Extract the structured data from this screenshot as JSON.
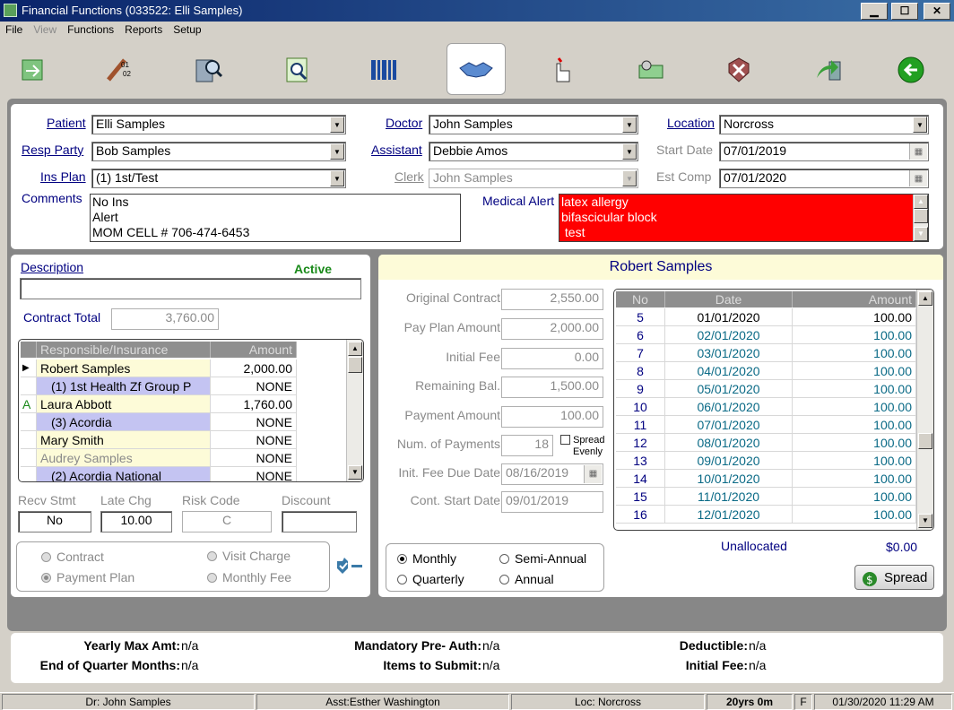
{
  "window": {
    "title": "Financial Functions (033522: Elli Samples)",
    "min": "▁",
    "max": "☐",
    "close": "✕"
  },
  "menu": {
    "file": "File",
    "view": "View",
    "functions": "Functions",
    "reports": "Reports",
    "setup": "Setup"
  },
  "toolbar": {
    "icons": [
      "transfer-icon",
      "calendar-dates-icon",
      "calculator-search-icon",
      "document-search-icon",
      "barcode-icon",
      "handshake-icon",
      "hand-pointer-icon",
      "money-gear-icon",
      "cancel-shield-icon",
      "arrow-forward-icon",
      "back-arrow-icon"
    ],
    "active_index": 5
  },
  "header": {
    "patient_label": "Patient",
    "patient": "Elli Samples",
    "resp_label": "Resp Party",
    "resp": "Bob Samples",
    "ins_label": "Ins Plan",
    "ins": "(1) 1st/Test",
    "comments_label": "Comments",
    "comments": [
      "No Ins",
      "Alert",
      "MOM CELL # 706-474-6453"
    ],
    "doctor_label": "Doctor",
    "doctor": "John Samples",
    "assistant_label": "Assistant",
    "assistant": "Debbie Amos",
    "clerk_label": "Clerk",
    "clerk": "John Samples",
    "location_label": "Location",
    "location": "Norcross",
    "start_label": "Start Date",
    "start": "07/01/2019",
    "estcomp_label": "Est Comp",
    "estcomp": "07/01/2020",
    "medalert_label": "Medical Alert",
    "medalert": [
      "latex allergy",
      "bifascicular block",
      " test"
    ]
  },
  "left": {
    "description_label": "Description",
    "status": "Active",
    "description": "",
    "contract_total_label": "Contract Total",
    "contract_total": "3,760.00",
    "grid_headers": [
      "Responsible/Insurance",
      "Amount"
    ],
    "rows": [
      {
        "marker": "▶",
        "name": "Robert Samples",
        "amount": "2,000.00",
        "style": "yellow"
      },
      {
        "marker": "",
        "name": "(1) 1st Health Zf Group P",
        "amount": "NONE",
        "style": "lav"
      },
      {
        "marker": "A",
        "name": "Laura Abbott",
        "amount": "1,760.00",
        "style": "yellow"
      },
      {
        "marker": "",
        "name": "(3) Acordia",
        "amount": "NONE",
        "style": "lav"
      },
      {
        "marker": "",
        "name": "Mary Smith",
        "amount": "NONE",
        "style": "yellow"
      },
      {
        "marker": "",
        "name": "Audrey Samples",
        "amount": "NONE",
        "style": "yellowgray"
      },
      {
        "marker": "",
        "name": "(2) Acordia National",
        "amount": "NONE",
        "style": "lav"
      }
    ],
    "recv_label": "Recv Stmt",
    "recv": "No",
    "late_label": "Late Chg",
    "late": "10.00",
    "risk_label": "Risk Code",
    "risk": "C",
    "discount_label": "Discount",
    "discount": "",
    "radio_contract": "Contract",
    "radio_payplan": "Payment Plan",
    "radio_visit": "Visit Charge",
    "radio_monthly_fee": "Monthly Fee"
  },
  "right": {
    "name": "Robert Samples",
    "orig_label": "Original Contract",
    "orig": "2,550.00",
    "payplan_label": "Pay Plan Amount",
    "payplan": "2,000.00",
    "initfee_label": "Initial Fee",
    "initfee": "0.00",
    "remain_label": "Remaining Bal.",
    "remain": "1,500.00",
    "payamt_label": "Payment Amount",
    "payamt": "100.00",
    "numpay_label": "Num. of Payments",
    "numpay": "18",
    "spread_evenly_1": "Spread",
    "spread_evenly_2": "Evenly",
    "initdue_label": "Init. Fee Due Date",
    "initdue": "08/16/2019",
    "contstart_label": "Cont. Start Date",
    "contstart": "09/01/2019",
    "freq": {
      "monthly": "Monthly",
      "semi": "Semi-Annual",
      "quarterly": "Quarterly",
      "annual": "Annual"
    },
    "sched_headers": [
      "No",
      "Date",
      "Amount"
    ],
    "schedule": [
      {
        "no": "5",
        "date": "01/01/2020",
        "amount": "100.00"
      },
      {
        "no": "6",
        "date": "02/01/2020",
        "amount": "100.00"
      },
      {
        "no": "7",
        "date": "03/01/2020",
        "amount": "100.00"
      },
      {
        "no": "8",
        "date": "04/01/2020",
        "amount": "100.00"
      },
      {
        "no": "9",
        "date": "05/01/2020",
        "amount": "100.00"
      },
      {
        "no": "10",
        "date": "06/01/2020",
        "amount": "100.00"
      },
      {
        "no": "11",
        "date": "07/01/2020",
        "amount": "100.00"
      },
      {
        "no": "12",
        "date": "08/01/2020",
        "amount": "100.00"
      },
      {
        "no": "13",
        "date": "09/01/2020",
        "amount": "100.00"
      },
      {
        "no": "14",
        "date": "10/01/2020",
        "amount": "100.00"
      },
      {
        "no": "15",
        "date": "11/01/2020",
        "amount": "100.00"
      },
      {
        "no": "16",
        "date": "12/01/2020",
        "amount": "100.00"
      }
    ],
    "unalloc_label": "Unallocated",
    "unalloc": "$0.00",
    "spread_button": "Spread"
  },
  "bottom": {
    "yearly_label": "Yearly Max Amt:",
    "yearly": "n/a",
    "eoq_label": "End of Quarter Months:",
    "eoq": "n/a",
    "preauth_label": "Mandatory Pre- Auth:",
    "preauth": "n/a",
    "items_label": "Items to Submit:",
    "items": "n/a",
    "deduct_label": "Deductible:",
    "deduct": "n/a",
    "initfee_label": "Initial Fee:",
    "initfee": "n/a"
  },
  "status": {
    "doctor": "Dr: John Samples",
    "assistant": "Asst:Esther Washington",
    "location": "Loc: Norcross",
    "age": "20yrs 0m",
    "sex": "F",
    "datetime": "01/30/2020 11:29 AM"
  }
}
